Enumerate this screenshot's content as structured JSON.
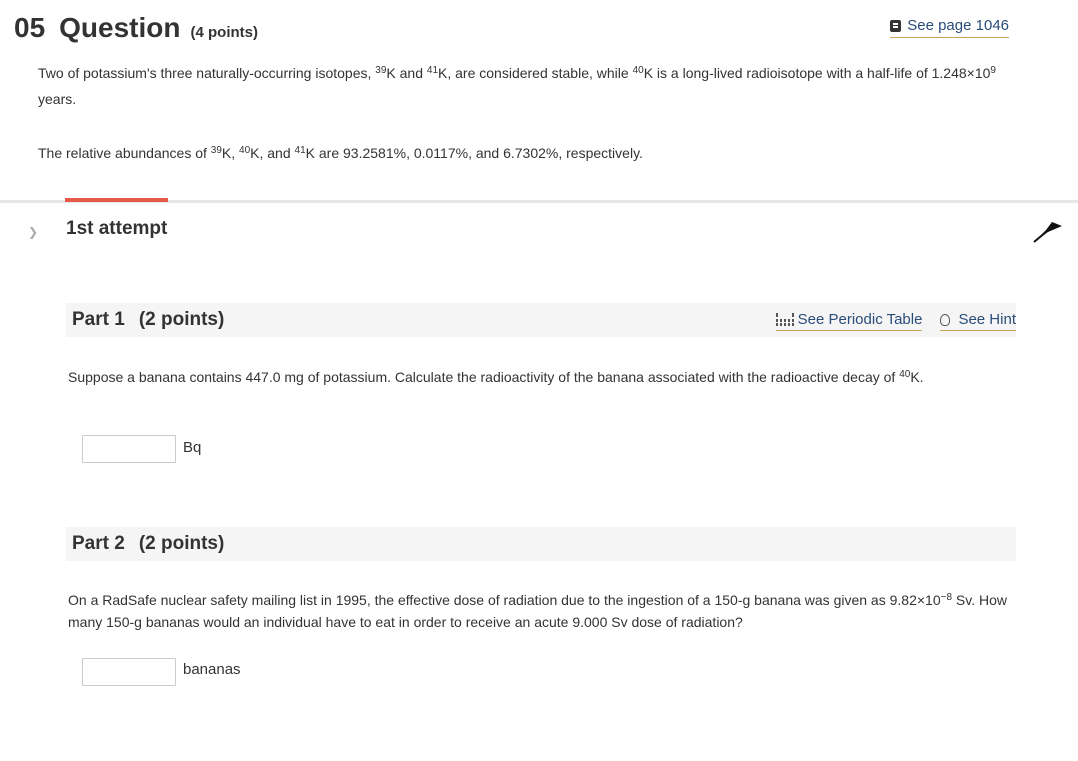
{
  "question": {
    "number": "05",
    "title": "Question",
    "points": "(4 points)",
    "see_page": "See page 1046"
  },
  "intro": {
    "p1_a": "Two of potassium's three naturally-occurring isotopes, ",
    "p1_sup1": "39",
    "p1_b": "K and ",
    "p1_sup2": "41",
    "p1_c": "K, are considered stable, while ",
    "p1_sup3": "40",
    "p1_d": "K is a long-lived radioisotope with a half-life of 1.248×10",
    "p1_sup4": "9",
    "p1_e": " years.",
    "p2_a": "The relative abundances of ",
    "p2_sup1": "39",
    "p2_b": "K, ",
    "p2_sup2": "40",
    "p2_c": "K, and ",
    "p2_sup3": "41",
    "p2_d": "K are 93.2581%, 0.0117%, and 6.7302%, respectively."
  },
  "attempt": {
    "label": "1st attempt"
  },
  "part1": {
    "label": "Part 1",
    "points": "(2 points)",
    "periodic_link": "See Periodic Table",
    "hint_link": "See Hint",
    "text_a": "Suppose a banana contains 447.0 mg of potassium. Calculate the radioactivity of the banana associated with the radioactive decay of ",
    "text_sup": "40",
    "text_b": "K.",
    "answer_value": "",
    "unit": "Bq"
  },
  "part2": {
    "label": "Part 2",
    "points": "(2 points)",
    "text_a": "On a RadSafe nuclear safety mailing list in 1995, the effective dose of radiation due to the ingestion of a 150-g banana was given as 9.82×10",
    "text_sup": "−8",
    "text_b": " Sv. How many 150-g bananas would an individual have to eat in order to receive an acute 9.000 Sv dose of radiation?",
    "answer_value": "",
    "unit": "bananas"
  },
  "colors": {
    "accent": "#e7594a",
    "link": "#2a4d7a",
    "link_underline": "#caa35c"
  }
}
